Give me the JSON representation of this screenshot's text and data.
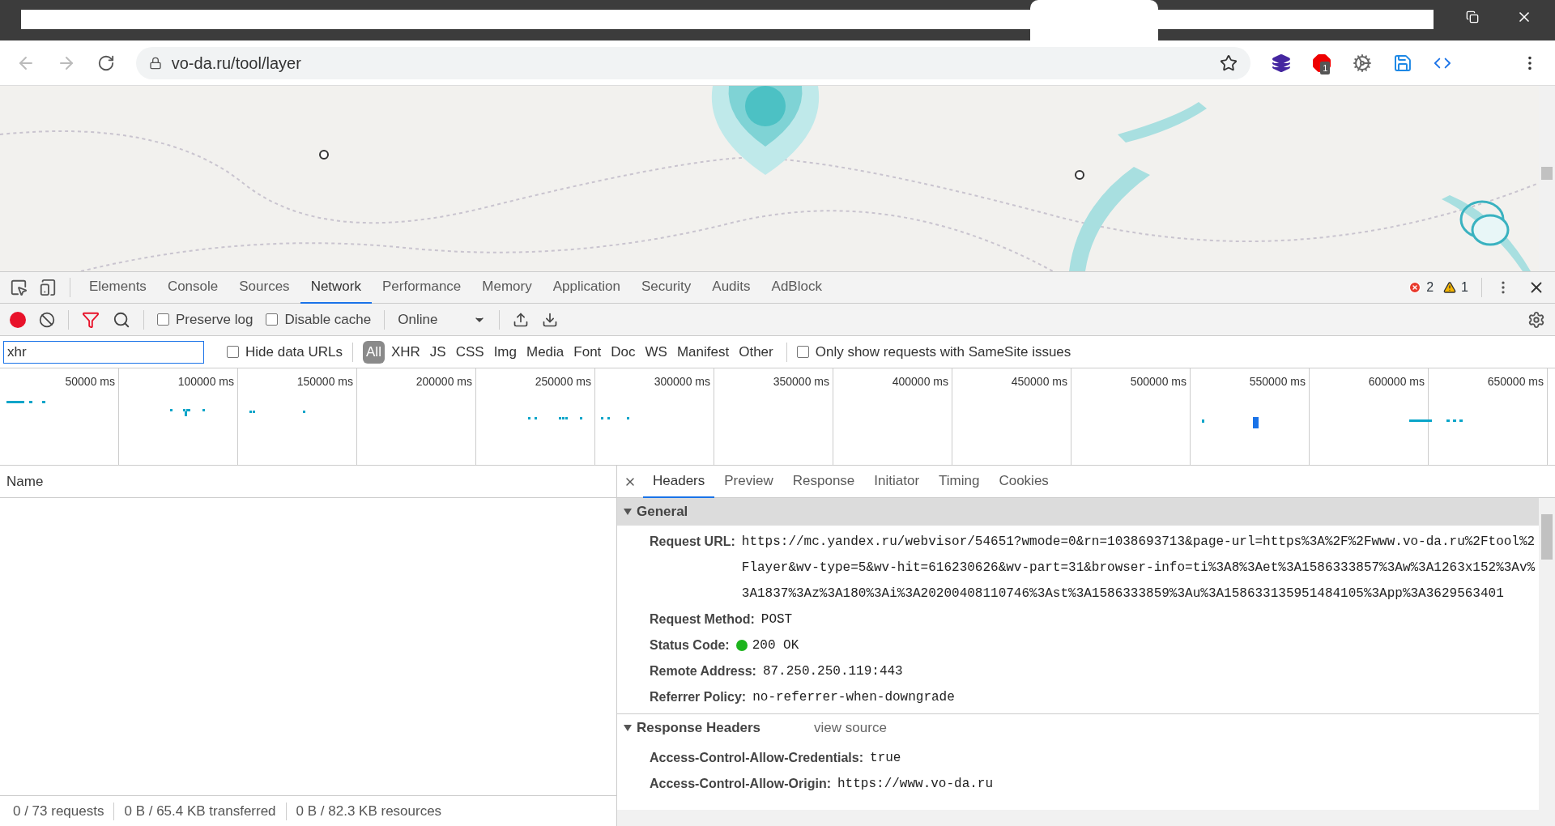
{
  "browser": {
    "address": "vo-da.ru/tool/layer",
    "extension_badge": "1"
  },
  "devtools": {
    "tabs": [
      {
        "label": "Elements",
        "selected": false
      },
      {
        "label": "Console",
        "selected": false
      },
      {
        "label": "Sources",
        "selected": false
      },
      {
        "label": "Network",
        "selected": true
      },
      {
        "label": "Performance",
        "selected": false
      },
      {
        "label": "Memory",
        "selected": false
      },
      {
        "label": "Application",
        "selected": false
      },
      {
        "label": "Security",
        "selected": false
      },
      {
        "label": "Audits",
        "selected": false
      },
      {
        "label": "AdBlock",
        "selected": false
      }
    ],
    "error_count": "2",
    "warning_count": "1"
  },
  "toolbar": {
    "recording": true,
    "preserve_log": {
      "label": "Preserve log",
      "checked": false
    },
    "disable_cache": {
      "label": "Disable cache",
      "checked": false
    },
    "throttling": "Online"
  },
  "filter": {
    "value": "xhr",
    "hide_data_urls": {
      "label": "Hide data URLs",
      "checked": false
    },
    "types": [
      {
        "label": "All",
        "selected": true
      },
      {
        "label": "XHR",
        "selected": false
      },
      {
        "label": "JS",
        "selected": false
      },
      {
        "label": "CSS",
        "selected": false
      },
      {
        "label": "Img",
        "selected": false
      },
      {
        "label": "Media",
        "selected": false
      },
      {
        "label": "Font",
        "selected": false
      },
      {
        "label": "Doc",
        "selected": false
      },
      {
        "label": "WS",
        "selected": false
      },
      {
        "label": "Manifest",
        "selected": false
      },
      {
        "label": "Other",
        "selected": false
      }
    ],
    "samesite": {
      "label": "Only show requests with SameSite issues",
      "checked": false
    }
  },
  "timeline": {
    "ticks": [
      "50000 ms",
      "100000 ms",
      "150000 ms",
      "200000 ms",
      "250000 ms",
      "300000 ms",
      "350000 ms",
      "400000 ms",
      "450000 ms",
      "500000 ms",
      "550000 ms",
      "600000 ms",
      "650000 ms"
    ]
  },
  "requests": {
    "column": "Name"
  },
  "details": {
    "tabs": [
      {
        "label": "Headers",
        "selected": true
      },
      {
        "label": "Preview",
        "selected": false
      },
      {
        "label": "Response",
        "selected": false
      },
      {
        "label": "Initiator",
        "selected": false
      },
      {
        "label": "Timing",
        "selected": false
      },
      {
        "label": "Cookies",
        "selected": false
      }
    ],
    "sections": [
      {
        "title": "General",
        "expanded": true,
        "rows": [
          {
            "key": "Request URL:",
            "value": "https://mc.yandex.ru/webvisor/54651?wmode=0&rn=1038693713&page-url=https%3A%2F%2Fwww.vo-da.ru%2Ftool%2Flayer&wv-type=5&wv-hit=616230626&wv-part=31&browser-info=ti%3A8%3Aet%3A1586333857%3Aw%3A1263x152%3Av%3A1837%3Az%3A180%3Ai%3A20200408110746%3Ast%3A1586333859%3Au%3A158633135951484105%3App%3A3629563401",
            "kind": "text"
          },
          {
            "key": "Request Method:",
            "value": "POST",
            "kind": "text"
          },
          {
            "key": "Status Code:",
            "value": "200 OK",
            "kind": "status",
            "color": "#1db41d"
          },
          {
            "key": "Remote Address:",
            "value": "87.250.250.119:443",
            "kind": "text"
          },
          {
            "key": "Referrer Policy:",
            "value": "no-referrer-when-downgrade",
            "kind": "text"
          }
        ]
      },
      {
        "title": "Response Headers",
        "expanded": true,
        "link": "view source",
        "rows": [
          {
            "key": "Access-Control-Allow-Credentials:",
            "value": "true",
            "kind": "text"
          },
          {
            "key": "Access-Control-Allow-Origin:",
            "value": "https://www.vo-da.ru",
            "kind": "text"
          }
        ]
      }
    ]
  },
  "status_bar": [
    "0 / 73 requests",
    "0 B / 65.4 KB transferred",
    "0 B / 82.3 KB resources"
  ]
}
